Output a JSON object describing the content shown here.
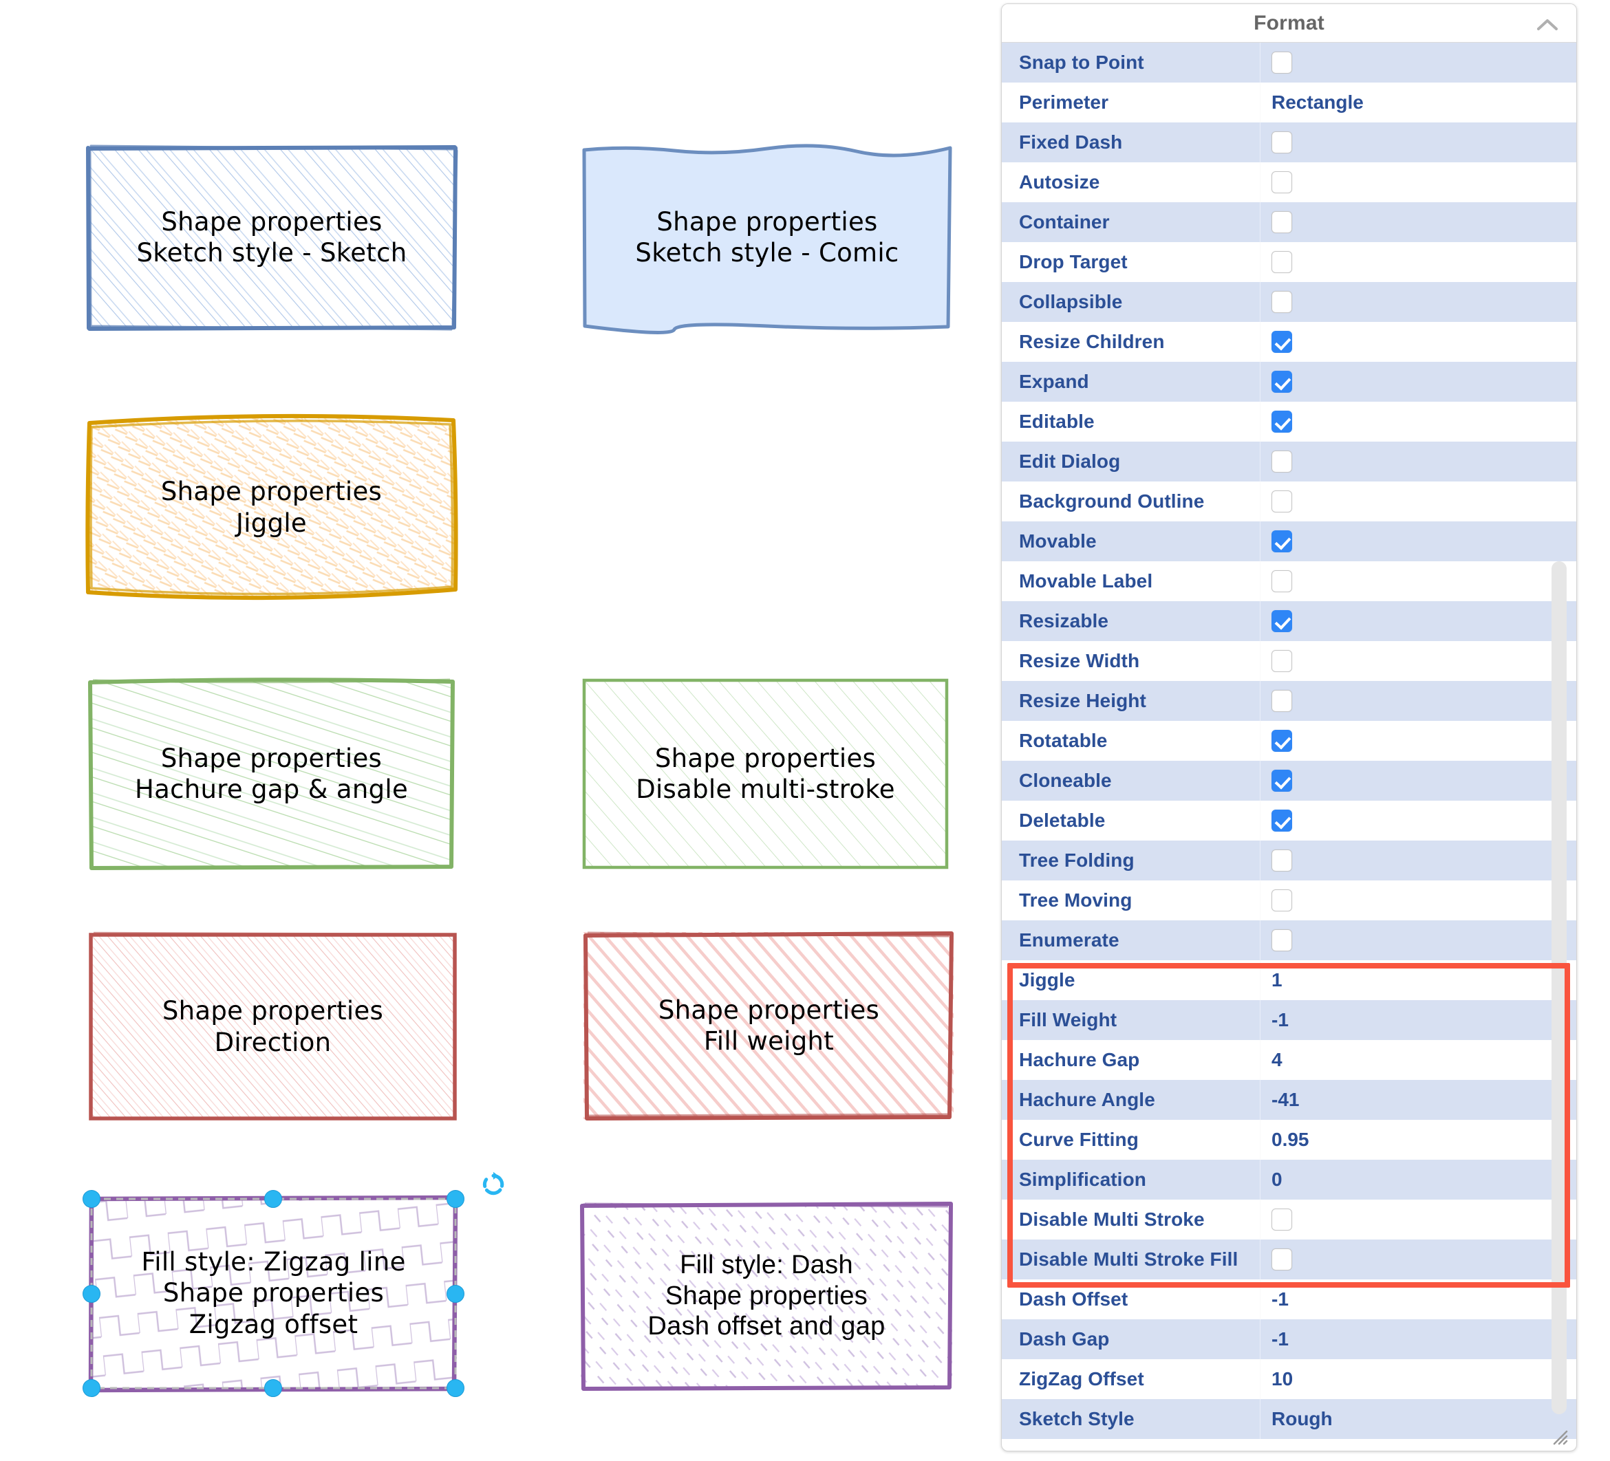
{
  "canvas": {
    "shapes": [
      {
        "id": "sketch-sketch",
        "label": "Shape properties\nSketch style - Sketch",
        "stroke": "#5b7fb5",
        "fill": "#c8d9f0",
        "style": "hachure-light"
      },
      {
        "id": "sketch-comic",
        "label": "Shape properties\nSketch style - Comic",
        "stroke": "#6c8ebf",
        "fill": "#dae8fc",
        "style": "comic-solid"
      },
      {
        "id": "jiggle",
        "label": "Shape properties\nJiggle",
        "stroke": "#d79b00",
        "fill": "#ffe6cc",
        "style": "jiggle-scribble"
      },
      {
        "id": "hachure-gap-angle",
        "label": "Shape properties\nHachure gap & angle",
        "stroke": "#82b366",
        "fill": "#d5e8d4",
        "style": "hachure-steep"
      },
      {
        "id": "disable-multi-stroke",
        "label": "Shape properties\nDisable multi-stroke",
        "stroke": "#82b366",
        "fill": "#d5e8d4",
        "style": "hachure-single"
      },
      {
        "id": "direction",
        "label": "Shape properties\nDirection",
        "stroke": "#b85450",
        "fill": "#f8cecc",
        "style": "hachure-dense"
      },
      {
        "id": "fill-weight",
        "label": "Shape properties\nFill weight",
        "stroke": "#b85450",
        "fill": "#f8cecc",
        "style": "hachure-thick"
      },
      {
        "id": "zigzag-offset",
        "label": "Fill style: Zigzag line\nShape properties\nZigzag offset",
        "stroke": "#8e5ea8",
        "fill": "#e1d5e7",
        "style": "zigzag",
        "selected": true
      },
      {
        "id": "dash-offset-gap",
        "label": "Fill style: Dash\nShape properties\nDash offset and gap",
        "stroke": "#8e5ea8",
        "fill": "#e1d5e7",
        "style": "dash-fill",
        "font": "plain"
      }
    ]
  },
  "format_panel": {
    "title": "Format",
    "collapse_icon": "chevron-up-icon",
    "highlight_color": "#f9543e",
    "accent_text_color": "#2b4f96",
    "alt_row_color": "#d7e0f2",
    "checkbox_checked_color": "#2f86f6",
    "rows": [
      {
        "key": "Snap to Point",
        "type": "checkbox",
        "checked": false
      },
      {
        "key": "Perimeter",
        "type": "text",
        "value": "Rectangle"
      },
      {
        "key": "Fixed Dash",
        "type": "checkbox",
        "checked": false
      },
      {
        "key": "Autosize",
        "type": "checkbox",
        "checked": false
      },
      {
        "key": "Container",
        "type": "checkbox",
        "checked": false
      },
      {
        "key": "Drop Target",
        "type": "checkbox",
        "checked": false
      },
      {
        "key": "Collapsible",
        "type": "checkbox",
        "checked": false
      },
      {
        "key": "Resize Children",
        "type": "checkbox",
        "checked": true
      },
      {
        "key": "Expand",
        "type": "checkbox",
        "checked": true
      },
      {
        "key": "Editable",
        "type": "checkbox",
        "checked": true
      },
      {
        "key": "Edit Dialog",
        "type": "checkbox",
        "checked": false
      },
      {
        "key": "Background Outline",
        "type": "checkbox",
        "checked": false
      },
      {
        "key": "Movable",
        "type": "checkbox",
        "checked": true
      },
      {
        "key": "Movable Label",
        "type": "checkbox",
        "checked": false
      },
      {
        "key": "Resizable",
        "type": "checkbox",
        "checked": true
      },
      {
        "key": "Resize Width",
        "type": "checkbox",
        "checked": false
      },
      {
        "key": "Resize Height",
        "type": "checkbox",
        "checked": false
      },
      {
        "key": "Rotatable",
        "type": "checkbox",
        "checked": true
      },
      {
        "key": "Cloneable",
        "type": "checkbox",
        "checked": true
      },
      {
        "key": "Deletable",
        "type": "checkbox",
        "checked": true
      },
      {
        "key": "Tree Folding",
        "type": "checkbox",
        "checked": false
      },
      {
        "key": "Tree Moving",
        "type": "checkbox",
        "checked": false
      },
      {
        "key": "Enumerate",
        "type": "checkbox",
        "checked": false
      },
      {
        "key": "Jiggle",
        "type": "text",
        "value": "1",
        "highlighted": true
      },
      {
        "key": "Fill Weight",
        "type": "text",
        "value": "-1",
        "highlighted": true
      },
      {
        "key": "Hachure Gap",
        "type": "text",
        "value": "4",
        "highlighted": true
      },
      {
        "key": "Hachure Angle",
        "type": "text",
        "value": "-41",
        "highlighted": true
      },
      {
        "key": "Curve Fitting",
        "type": "text",
        "value": "0.95",
        "highlighted": true
      },
      {
        "key": "Simplification",
        "type": "text",
        "value": "0",
        "highlighted": true
      },
      {
        "key": "Disable Multi Stroke",
        "type": "checkbox",
        "checked": false,
        "highlighted": true
      },
      {
        "key": "Disable Multi Stroke Fill",
        "type": "checkbox",
        "checked": false,
        "highlighted": true
      },
      {
        "key": "Dash Offset",
        "type": "text",
        "value": "-1",
        "highlighted": true
      },
      {
        "key": "Dash Gap",
        "type": "text",
        "value": "-1",
        "highlighted": true
      },
      {
        "key": "ZigZag Offset",
        "type": "text",
        "value": "10",
        "highlighted": true
      },
      {
        "key": "Sketch Style",
        "type": "text",
        "value": "Rough",
        "highlighted": true
      }
    ]
  }
}
